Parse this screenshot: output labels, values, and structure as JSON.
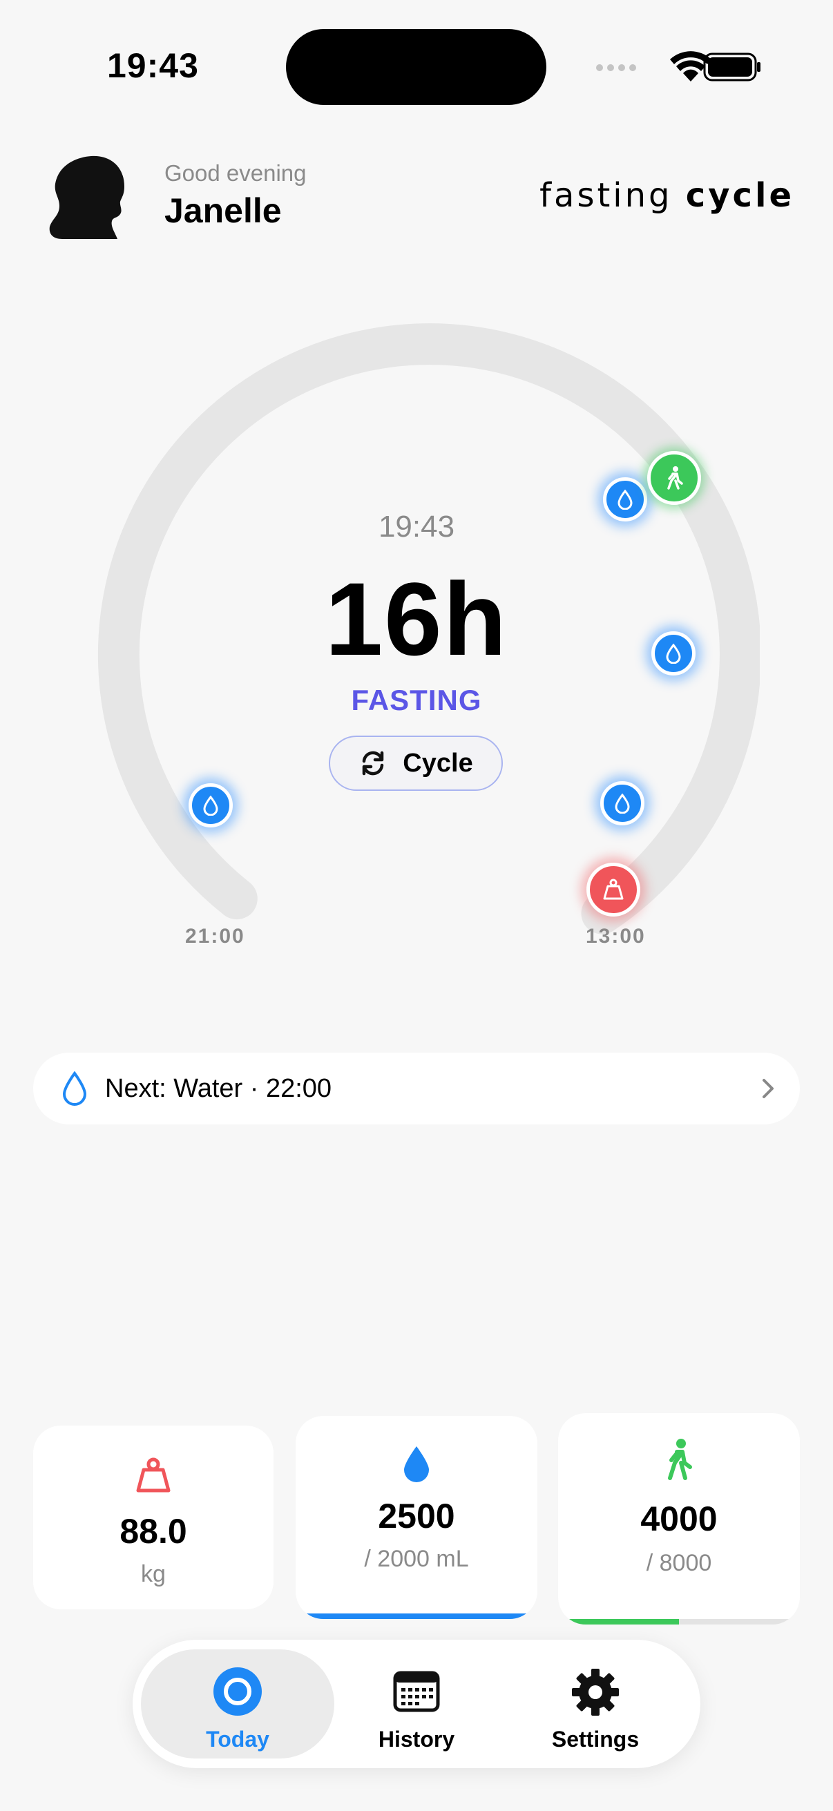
{
  "status_bar": {
    "time": "19:43"
  },
  "header": {
    "greeting": "Good evening",
    "user_name": "Janelle",
    "brand_part1": "fasting",
    "brand_part2": "cycle"
  },
  "timer": {
    "current_time": "19:43",
    "hours": "16h",
    "phase": "FASTING",
    "cycle_button_label": "Cycle",
    "start_label": "21:00",
    "end_label": "13:00"
  },
  "next": {
    "text": "Next: Water · 22:00"
  },
  "stats": {
    "weight": {
      "value": "88.0",
      "unit": "kg"
    },
    "water": {
      "value": "2500",
      "target": "/ 2000 mL",
      "progress": 1.0
    },
    "steps": {
      "value": "4000",
      "target": "/ 8000",
      "progress": 0.5
    }
  },
  "tabs": [
    {
      "label": "Today",
      "active": true
    },
    {
      "label": "History",
      "active": false
    },
    {
      "label": "Settings",
      "active": false
    }
  ],
  "colors": {
    "accent_blue": "#1e88f5",
    "fasting_purple": "#5b56e6",
    "weight_red": "#f0555a",
    "steps_green": "#3cc85a"
  }
}
